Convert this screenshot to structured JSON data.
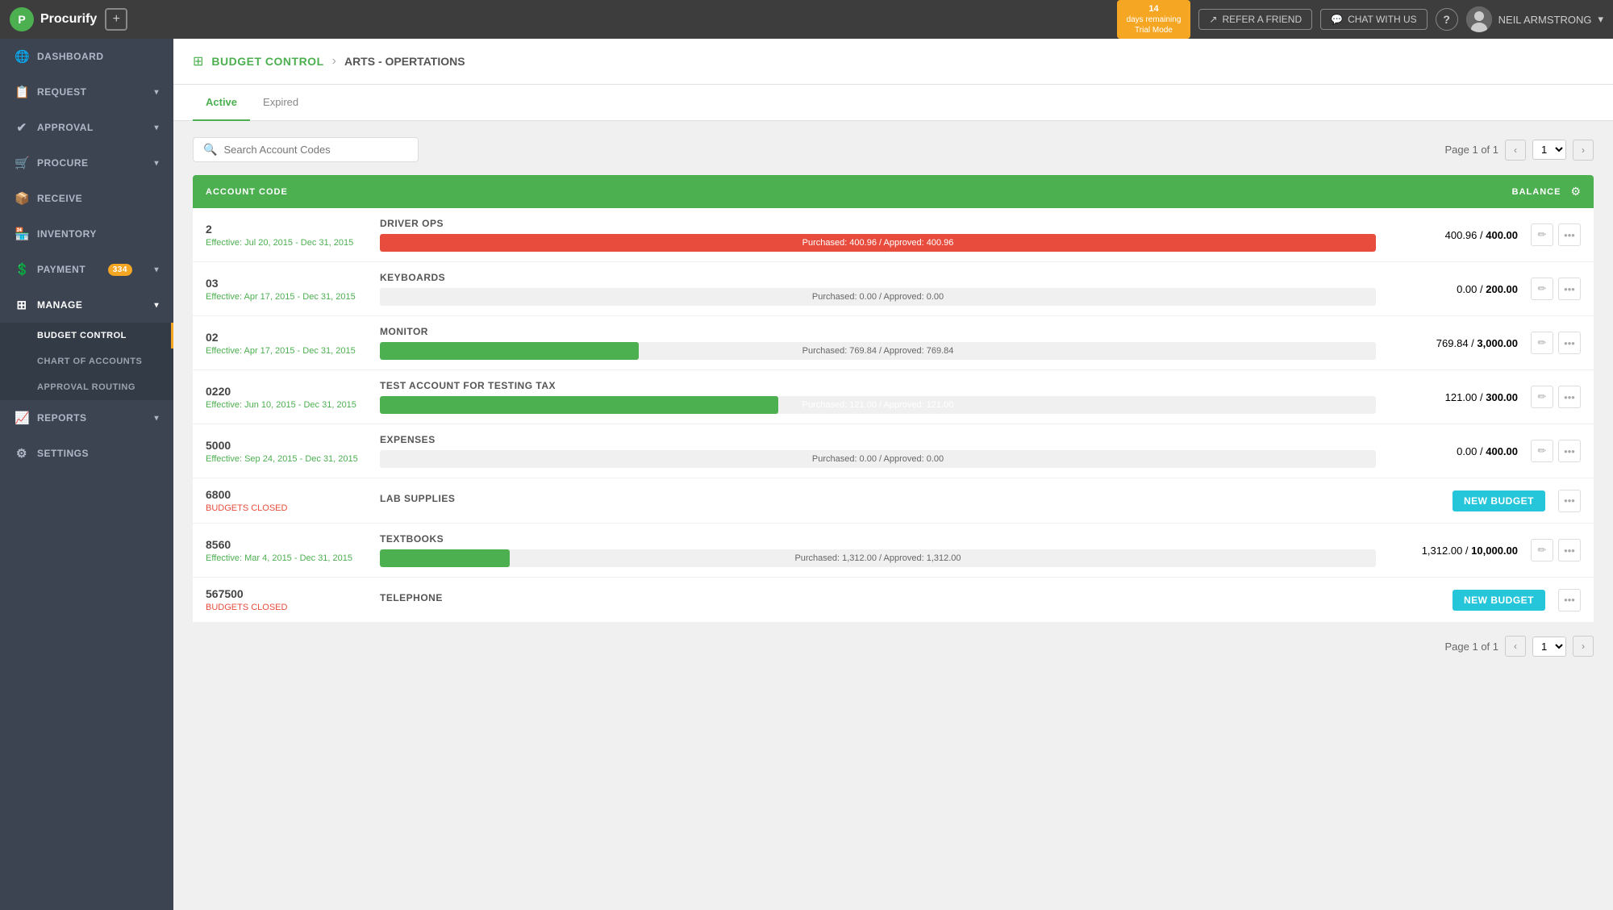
{
  "topnav": {
    "logo_text": "Procurify",
    "add_label": "+",
    "trial_days": "14",
    "trial_label": "days remaining",
    "trial_mode": "Trial Mode",
    "refer_label": "REFER A FRIEND",
    "chat_label": "CHAT WITH US",
    "help_label": "?",
    "user_name": "NEIL ARMSTRONG",
    "chevron": "▾"
  },
  "sidebar": {
    "items": [
      {
        "id": "dashboard",
        "label": "Dashboard",
        "icon": "🌐"
      },
      {
        "id": "request",
        "label": "Request",
        "icon": "📋",
        "has_chevron": true
      },
      {
        "id": "approval",
        "label": "Approval",
        "icon": "✔",
        "has_chevron": true
      },
      {
        "id": "procure",
        "label": "Procure",
        "icon": "🛒",
        "has_chevron": true
      },
      {
        "id": "receive",
        "label": "Receive",
        "icon": "📦"
      },
      {
        "id": "inventory",
        "label": "Inventory",
        "icon": "🏪"
      },
      {
        "id": "payment",
        "label": "Payment",
        "icon": "💲",
        "badge": "334",
        "has_chevron": true
      },
      {
        "id": "manage",
        "label": "Manage",
        "icon": "⊞",
        "has_chevron": true,
        "active": true
      }
    ],
    "submenu": [
      {
        "id": "budget-control",
        "label": "Budget Control",
        "active": true
      },
      {
        "id": "chart-of-accounts",
        "label": "Chart of Accounts"
      },
      {
        "id": "approval-routing",
        "label": "Approval Routing"
      }
    ],
    "settings": {
      "id": "settings",
      "label": "Settings",
      "icon": "⚙"
    },
    "reports": {
      "id": "reports",
      "label": "Reports",
      "icon": "📈",
      "has_chevron": true
    }
  },
  "breadcrumb": {
    "icon": "⊞",
    "link_label": "BUDGET CONTROL",
    "separator": "›",
    "current": "ARTS - OPERTATIONS"
  },
  "tabs": [
    {
      "id": "active",
      "label": "Active",
      "active": true
    },
    {
      "id": "expired",
      "label": "Expired"
    }
  ],
  "toolbar": {
    "search_placeholder": "Search Account Codes",
    "page_info": "Page 1 of 1",
    "page_value": "1"
  },
  "table": {
    "header": {
      "account_code": "ACCOUNT CODE",
      "balance": "BALANCE"
    },
    "rows": [
      {
        "code": "2",
        "effective": "Effective: Jul 20, 2015 - Dec 31, 2015",
        "name": "DRIVER OPS",
        "purchased": 400.96,
        "approved": 400.96,
        "total": 400.0,
        "progress_pct": 100,
        "bar_color": "#e74c3c",
        "bar_text": "Purchased: 400.96 / Approved: 400.96",
        "balance_display": "400.96 / 400.00",
        "status": "effective",
        "has_actions": true
      },
      {
        "code": "03",
        "effective": "Effective: Apr 17, 2015 - Dec 31, 2015",
        "name": "KEYBOARDS",
        "purchased": 0.0,
        "approved": 0.0,
        "total": 200.0,
        "progress_pct": 0,
        "bar_color": "#e0e0e0",
        "bar_text": "Purchased: 0.00 / Approved: 0.00",
        "balance_display": "0.00 / 200.00",
        "status": "effective",
        "has_actions": true
      },
      {
        "code": "02",
        "effective": "Effective: Apr 17, 2015 - Dec 31, 2015",
        "name": "MONITOR",
        "purchased": 769.84,
        "approved": 769.84,
        "total": 3000.0,
        "progress_pct": 26,
        "bar_color": "#4caf50",
        "bar_text": "Purchased: 769.84 / Approved: 769.84",
        "balance_display": "769.84 / 3,000.00",
        "status": "effective",
        "has_actions": true
      },
      {
        "code": "0220",
        "effective": "Effective: Jun 10, 2015 - Dec 31, 2015",
        "name": "TEST ACCOUNT FOR TESTING TAX",
        "purchased": 121.0,
        "approved": 121.0,
        "total": 300.0,
        "progress_pct": 40,
        "bar_color": "#4caf50",
        "bar_text": "Purchased: 121.00 / Approved: 121.00",
        "balance_display": "121.00 / 300.00",
        "status": "effective",
        "has_actions": true
      },
      {
        "code": "5000",
        "effective": "Effective: Sep 24, 2015 - Dec 31, 2015",
        "name": "EXPENSES",
        "purchased": 0.0,
        "approved": 0.0,
        "total": 400.0,
        "progress_pct": 0,
        "bar_color": "#e0e0e0",
        "bar_text": "Purchased: 0.00 / Approved: 0.00",
        "balance_display": "0.00 / 400.00",
        "status": "effective",
        "has_actions": true
      },
      {
        "code": "6800",
        "effective": "BUDGETS CLOSED",
        "name": "LAB SUPPLIES",
        "purchased": null,
        "approved": null,
        "total": null,
        "progress_pct": null,
        "bar_color": null,
        "bar_text": null,
        "balance_display": null,
        "status": "closed",
        "has_actions": false,
        "new_budget_label": "NEW BUDGET"
      },
      {
        "code": "8560",
        "effective": "Effective: Mar 4, 2015 - Dec 31, 2015",
        "name": "TEXTBOOKS",
        "purchased": 1312.0,
        "approved": 1312.0,
        "total": 10000.0,
        "progress_pct": 13,
        "bar_color": "#4caf50",
        "bar_text": "Purchased: 1,312.00 / Approved: 1,312.00",
        "balance_display": "1,312.00 / 10,000.00",
        "status": "effective",
        "has_actions": true
      },
      {
        "code": "567500",
        "effective": "BUDGETS CLOSED",
        "name": "TELEPHONE",
        "purchased": null,
        "approved": null,
        "total": null,
        "progress_pct": null,
        "bar_color": null,
        "bar_text": null,
        "balance_display": null,
        "status": "closed",
        "has_actions": false,
        "new_budget_label": "NEW BUDGET"
      }
    ]
  },
  "colors": {
    "green": "#4caf50",
    "red": "#e74c3c",
    "teal": "#26c6da",
    "orange": "#f5a623"
  }
}
